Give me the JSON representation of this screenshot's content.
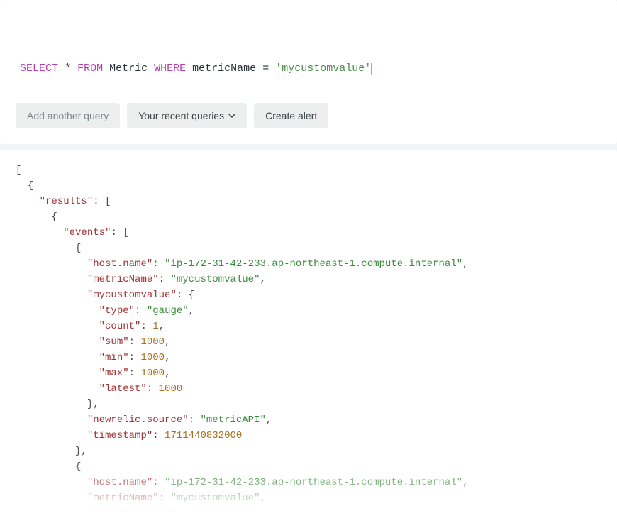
{
  "query": {
    "tokens": [
      {
        "t": "SELECT",
        "cls": "kw"
      },
      {
        "t": " "
      },
      {
        "t": "*",
        "cls": "id"
      },
      {
        "t": " "
      },
      {
        "t": "FROM",
        "cls": "kw"
      },
      {
        "t": " "
      },
      {
        "t": "Metric",
        "cls": "id"
      },
      {
        "t": " "
      },
      {
        "t": "WHERE",
        "cls": "kw"
      },
      {
        "t": " "
      },
      {
        "t": "metricName",
        "cls": "id"
      },
      {
        "t": " "
      },
      {
        "t": "=",
        "cls": "id"
      },
      {
        "t": " "
      },
      {
        "t": "'mycustomvalue'",
        "cls": "sqlstr"
      }
    ]
  },
  "buttons": {
    "add_query": "Add another query",
    "recent_queries": "Your recent queries",
    "create_alert": "Create alert"
  },
  "json_result": {
    "results": [
      {
        "events": [
          {
            "host.name": "ip-172-31-42-233.ap-northeast-1.compute.internal",
            "metricName": "mycustomvalue",
            "mycustomvalue": {
              "type": "gauge",
              "count": 1,
              "sum": 1000,
              "min": 1000,
              "max": 1000,
              "latest": 1000
            },
            "newrelic.source": "metricAPI",
            "timestamp": 1711440832000
          },
          {
            "host.name": "ip-172-31-42-233.ap-northeast-1.compute.internal",
            "metricName": "mycustomvalue",
            "mycustomvalue": {}
          }
        ]
      }
    ]
  },
  "fade_rules": {
    "faded1": [
      "22"
    ],
    "faded2": [
      "23"
    ],
    "faded3": [
      "24"
    ]
  }
}
